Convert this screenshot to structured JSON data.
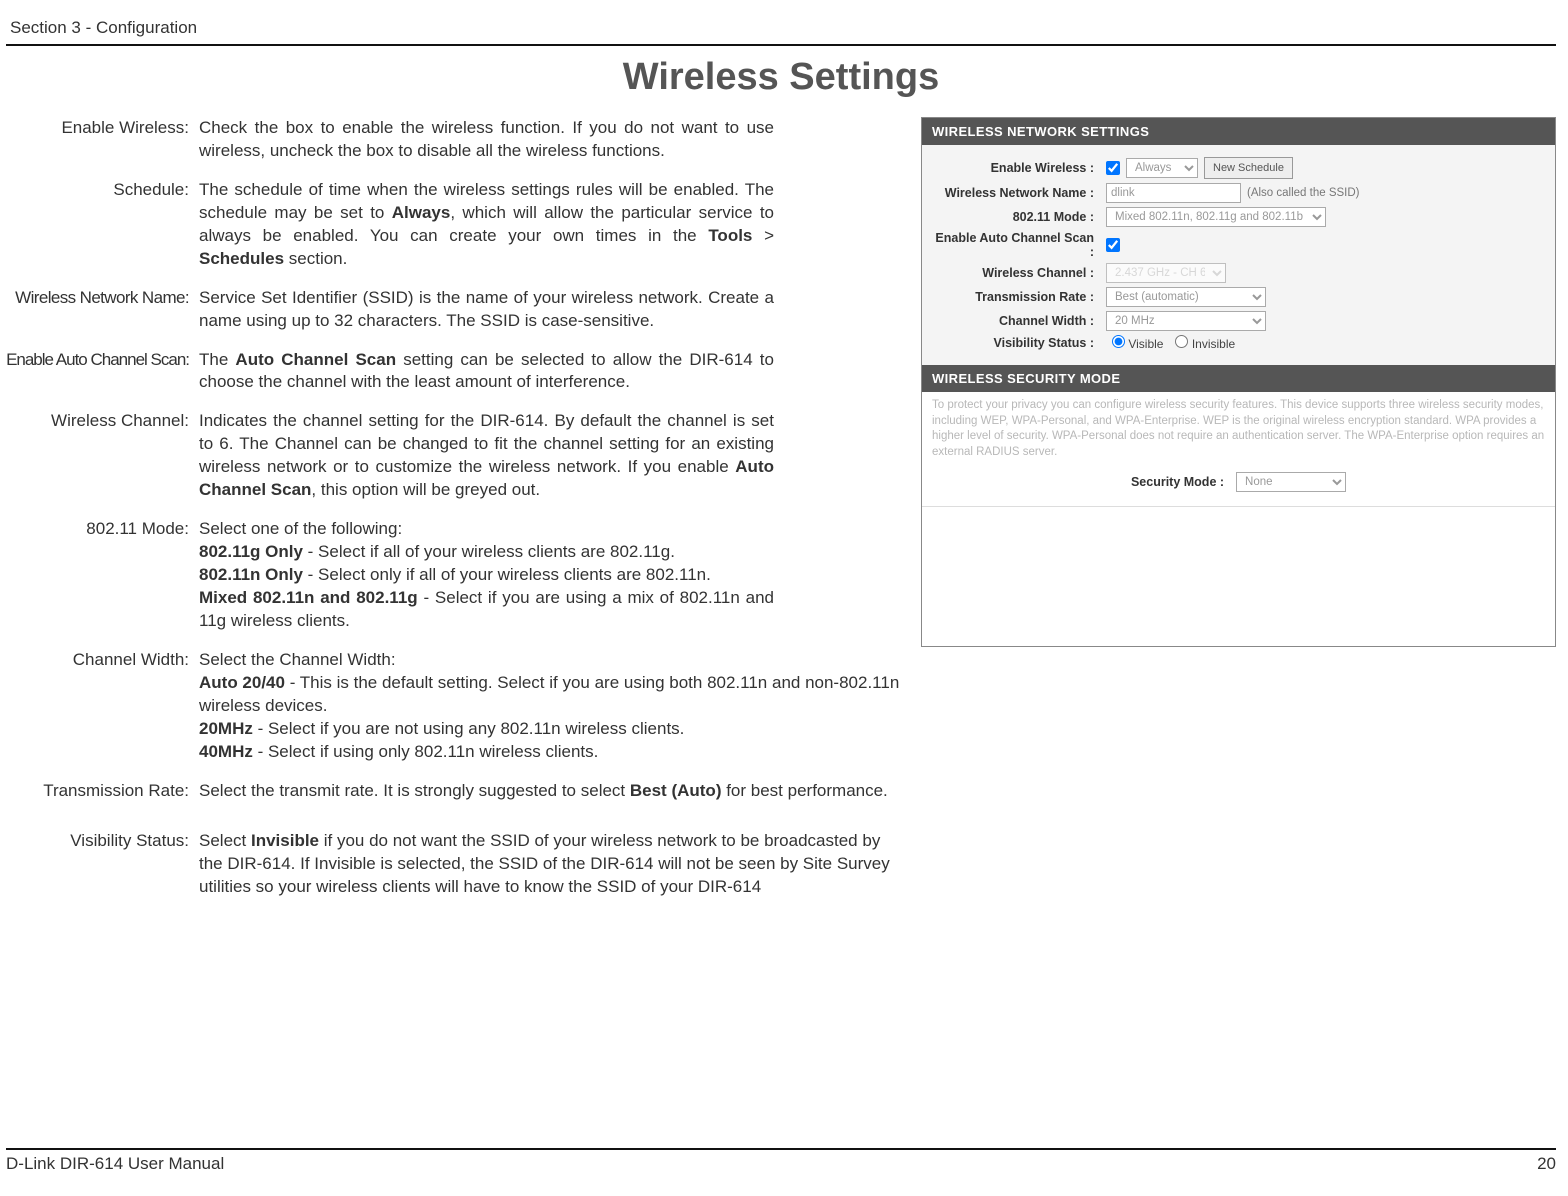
{
  "header": {
    "section": "Section 3 - Configuration"
  },
  "title": "Wireless Settings",
  "defs": {
    "enable_wireless": {
      "label": "Enable Wireless:",
      "desc": "Check the box to enable the wireless function. If you do not want to use wireless, uncheck the box to disable all the wireless functions."
    },
    "schedule": {
      "label": "Schedule:",
      "desc_pre": "The schedule of time when the wireless settings rules will be enabled. The schedule may be set to ",
      "b1": "Always",
      "desc_mid": ", which will allow the particular service to always be enabled. You can create your own times in the ",
      "b2": "Tools",
      "gt": " > ",
      "b3": "Schedules",
      "desc_end": " section."
    },
    "network_name": {
      "label": "Wireless Network Name:",
      "desc": "Service Set Identifier (SSID) is the name of your wireless network. Create a name using up to 32 characters. The SSID is case-sensitive."
    },
    "auto_scan": {
      "label": "Enable Auto Channel Scan:",
      "desc_pre": "The ",
      "b1": "Auto Channel Scan",
      "desc_end": " setting can be selected to allow the DIR-614 to choose the channel with the least amount of interference."
    },
    "channel": {
      "label": "Wireless Channel:",
      "desc_pre": "Indicates the channel setting for the DIR-614. By default the channel is set to 6. The Channel can be changed to fit the channel setting for an existing wireless network or to customize the wireless network. If you enable ",
      "b1": "Auto Channel Scan",
      "desc_end": ", this option will be greyed out."
    },
    "mode": {
      "label": "802.11 Mode:",
      "l1": "Select one of the following:",
      "b1": "802.11g Only",
      "d1": " - Select if all of your wireless clients are 802.11g.",
      "b2": "802.11n Only",
      "d2": " - Select only if all of your wireless clients are 802.11n.",
      "b3": "Mixed 802.11n and 802.11g",
      "d3": " - Select if you are using a mix of 802.11n and 11g wireless clients."
    },
    "width": {
      "label": "Channel Width:",
      "l1": "Select the Channel Width:",
      "b1": "Auto 20/40",
      "d1": " - This is the default setting. Select if you are using both 802.11n and non-802.11n wireless devices.",
      "b2": "20MHz",
      "d2": " - Select if you are not using any 802.11n wireless clients.",
      "b3": "40MHz",
      "d3": " - Select if using only 802.11n wireless clients."
    },
    "rate": {
      "label": "Transmission Rate:",
      "desc_pre": "Select the transmit rate. It is strongly suggested to select ",
      "b1": "Best (Auto)",
      "desc_end": " for best performance."
    },
    "visibility": {
      "label": "Visibility Status:",
      "desc_pre": "Select ",
      "b1": "Invisible",
      "desc_end": " if you do not want the SSID of your wireless network to be broadcasted by the DIR-614. If Invisible is selected, the SSID of the DIR-614 will not be seen by Site Survey utilities so your wireless clients will have to know the SSID of your DIR-614"
    }
  },
  "screenshot": {
    "panel1": "WIRELESS NETWORK SETTINGS",
    "panel2": "WIRELESS SECURITY MODE",
    "rows": {
      "enable": "Enable Wireless :",
      "schedule_sel": "Always",
      "schedule_btn": "New Schedule",
      "name": "Wireless Network Name :",
      "name_val": "dlink",
      "name_note": "(Also called the SSID)",
      "mode": "802.11 Mode :",
      "mode_val": "Mixed 802.11n, 802.11g and 802.11b",
      "auto": "Enable Auto Channel Scan :",
      "channel": "Wireless Channel :",
      "channel_val": "2.437 GHz - CH 6",
      "rate": "Transmission Rate :",
      "rate_val": "Best (automatic)",
      "width": "Channel Width :",
      "width_val": "20 MHz",
      "vis": "Visibility Status :",
      "vis_visible": "Visible",
      "vis_invisible": "Invisible",
      "sec_text": "To protect your privacy you can configure wireless security features. This device supports three wireless security modes, including WEP, WPA-Personal, and WPA-Enterprise. WEP is the original wireless encryption standard. WPA provides a higher level of security. WPA-Personal does not require an authentication server. The WPA-Enterprise option requires an external RADIUS server.",
      "sec_mode": "Security Mode :",
      "sec_val": "None"
    }
  },
  "footer": {
    "manual": "D-Link DIR-614 User Manual",
    "page": "20"
  }
}
